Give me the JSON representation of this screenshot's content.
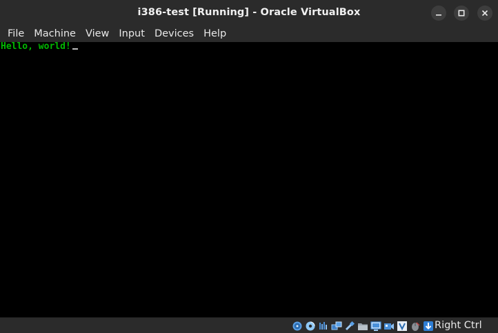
{
  "window": {
    "title": "i386-test [Running] - Oracle VirtualBox",
    "controls": [
      "minimize-icon",
      "maximize-icon",
      "close-icon"
    ]
  },
  "menubar": {
    "items": [
      "File",
      "Machine",
      "View",
      "Input",
      "Devices",
      "Help"
    ]
  },
  "screen": {
    "console_text": "Hello, world!",
    "text_color": "#00b800",
    "background": "#000000"
  },
  "statusbar": {
    "icons": [
      "hard-disk-icon",
      "optical-drive-icon",
      "audio-icon",
      "network-icon",
      "usb-icon",
      "shared-folders-icon",
      "display-icon",
      "video-capture-icon",
      "virtualization-icon",
      "mouse-integration-icon",
      "keyboard-icon"
    ],
    "host_key": "Right Ctrl"
  }
}
